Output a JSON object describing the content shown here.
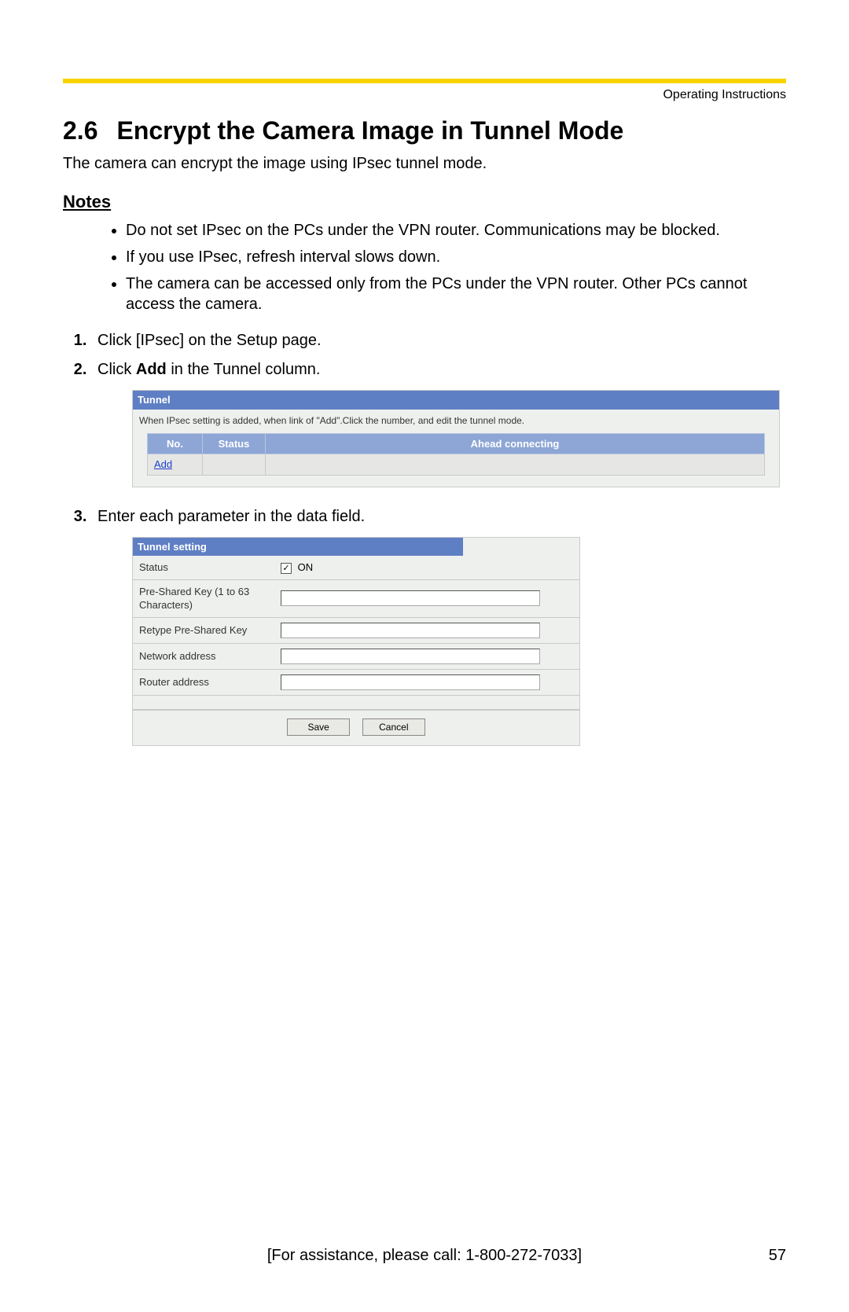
{
  "header": {
    "label": "Operating Instructions"
  },
  "section": {
    "number": "2.6",
    "title": "Encrypt the Camera Image in Tunnel Mode"
  },
  "intro": "The camera can encrypt the image using IPsec tunnel mode.",
  "notes": {
    "heading": "Notes",
    "items": [
      "Do not set IPsec on the PCs under the VPN router. Communications may be blocked.",
      "If you use IPsec, refresh interval slows down.",
      "The camera can be accessed only from the PCs under the VPN router. Other PCs cannot access the camera."
    ]
  },
  "steps": {
    "s1": "Click [IPsec] on the Setup page.",
    "s2_pre": "Click ",
    "s2_bold": "Add",
    "s2_post": " in the Tunnel column.",
    "s3": "Enter each parameter in the data field."
  },
  "tunnel": {
    "title": "Tunnel",
    "desc": "When IPsec setting is added, when link of \"Add\".Click the number, and edit the tunnel mode.",
    "headers": {
      "no": "No.",
      "status": "Status",
      "ahead": "Ahead connecting"
    },
    "add": "Add"
  },
  "setting": {
    "title": "Tunnel setting",
    "rows": {
      "status_label": "Status",
      "status_value": "ON",
      "psk_label": "Pre-Shared Key (1 to 63 Characters)",
      "repsk_label": "Retype Pre-Shared Key",
      "net_label": "Network address",
      "router_label": "Router address"
    },
    "buttons": {
      "save": "Save",
      "cancel": "Cancel"
    }
  },
  "footer": {
    "assist": "[For assistance, please call: 1-800-272-7033]",
    "page": "57"
  }
}
